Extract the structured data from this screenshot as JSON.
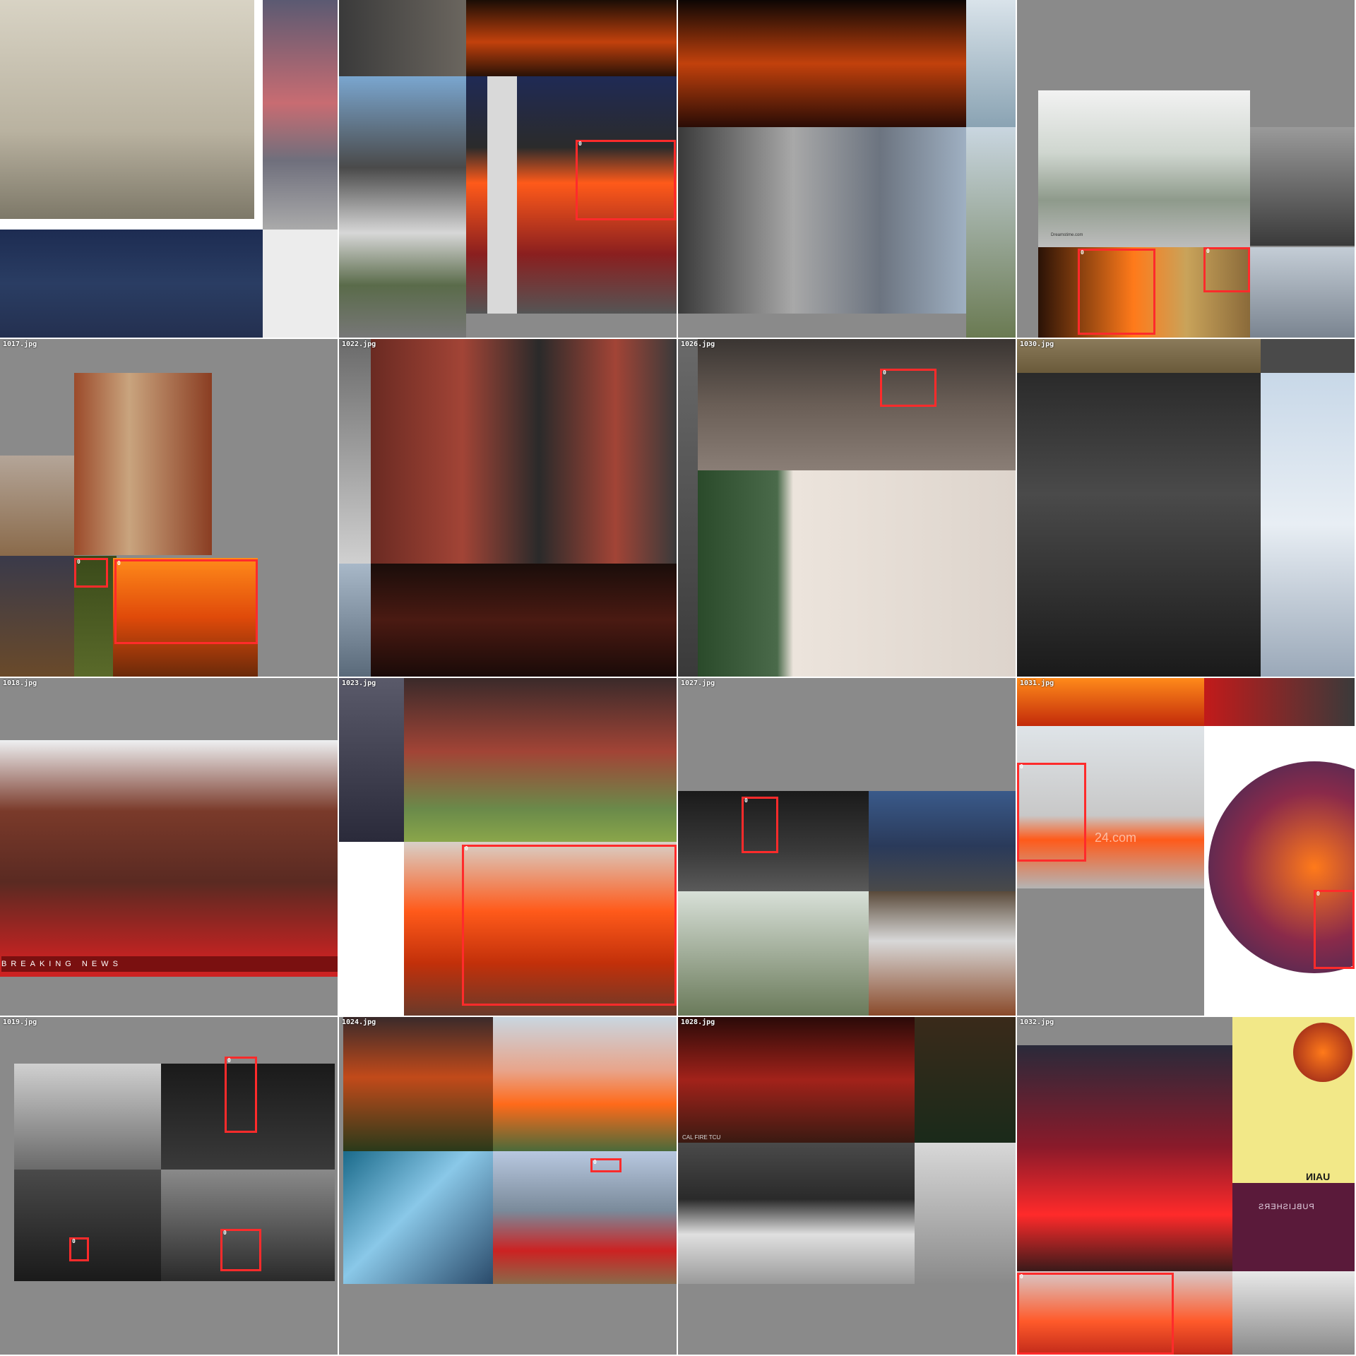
{
  "tiles": [
    {
      "label": ""
    },
    {
      "label": ""
    },
    {
      "label": ""
    },
    {
      "label": ""
    },
    {
      "label": "1017.jpg"
    },
    {
      "label": "1022.jpg"
    },
    {
      "label": "1026.jpg"
    },
    {
      "label": "1030.jpg"
    },
    {
      "label": "1018.jpg"
    },
    {
      "label": "1023.jpg"
    },
    {
      "label": "1027.jpg"
    },
    {
      "label": "1031.jpg"
    },
    {
      "label": "1019.jpg"
    },
    {
      "label": "1024.jpg"
    },
    {
      "label": "1028.jpg"
    },
    {
      "label": "1032.jpg"
    }
  ],
  "box_class": "0",
  "overlay_text": {
    "breaking_news": "BREAKING NEWS",
    "dreamstime": "Dreamstime.com",
    "watermark": "24.com",
    "cal_fire": "CAL FIRE TCU",
    "publisher_a": "UAIN",
    "publisher_b": "PUBLISHERS"
  }
}
